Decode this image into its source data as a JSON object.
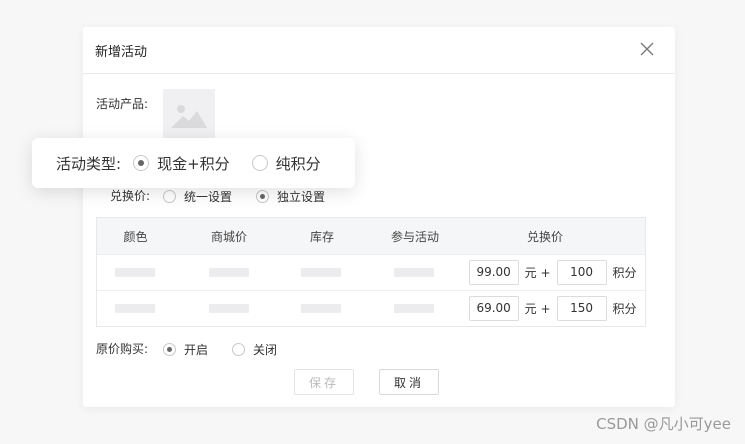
{
  "dialog": {
    "title": "新增活动",
    "product_label": "活动产品:",
    "exchange_label": "兑换价:",
    "exchange_options": [
      "统一设置",
      "独立设置"
    ],
    "exchange_selected": 1,
    "icons": {
      "close": "close-icon",
      "image": "image-placeholder-icon"
    }
  },
  "callout": {
    "label": "活动类型:",
    "options": [
      "现金+积分",
      "纯积分"
    ],
    "selected": 0
  },
  "table": {
    "headers": [
      "颜色",
      "商城价",
      "库存",
      "参与活动",
      "兑换价"
    ],
    "rows": [
      {
        "price": "99.00",
        "unit1": "元",
        "plus": "+",
        "points": "100",
        "unit2": "积分"
      },
      {
        "price": "69.00",
        "unit1": "元",
        "plus": "+",
        "points": "150",
        "unit2": "积分"
      }
    ]
  },
  "original_purchase": {
    "label": "原价购买:",
    "options": [
      "开启",
      "关闭"
    ],
    "selected": 0
  },
  "buttons": {
    "save": "保存",
    "cancel": "取消"
  },
  "watermark": "CSDN @凡小可yee"
}
